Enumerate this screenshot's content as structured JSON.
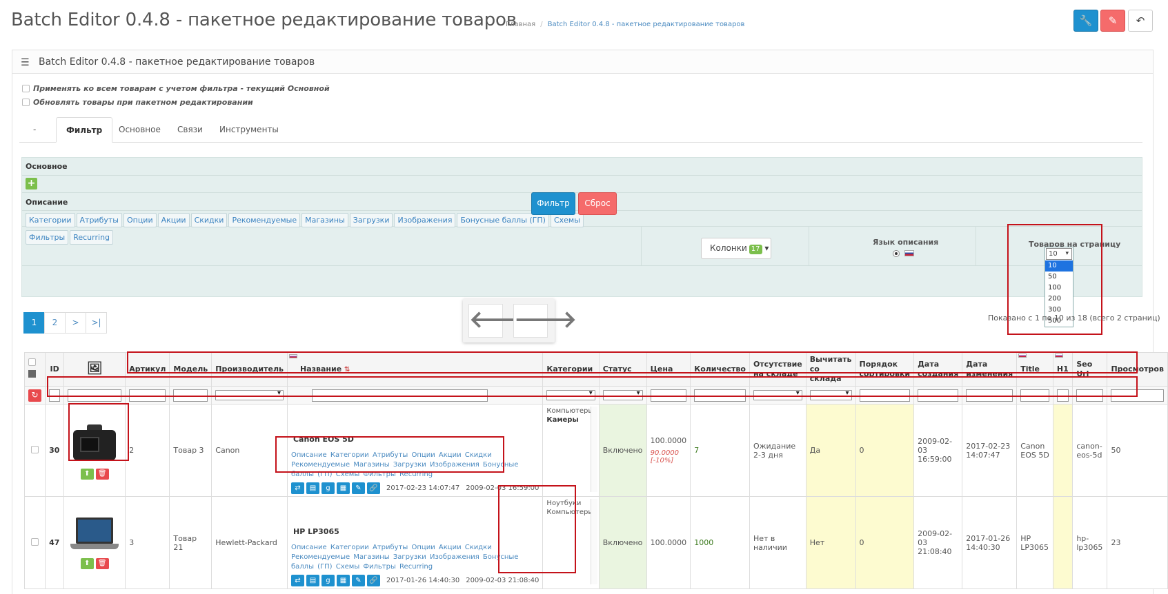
{
  "header": {
    "title": "Batch Editor 0.4.8 - пакетное редактирование товаров",
    "breadcrumb_home": "Главная",
    "breadcrumb_sep": "/",
    "breadcrumb_current": "Batch Editor 0.4.8 - пакетное редактирование товаров",
    "btn_settings_icon": "wrench-icon",
    "btn_clear_icon": "eraser-icon",
    "btn_back_icon": "back-icon"
  },
  "panel": {
    "title": "Batch Editor 0.4.8 - пакетное редактирование товаров",
    "opt_apply_all": "Применять ко всем товарам с учетом фильтра - текущий Основной",
    "opt_update": "Обновлять товары при пакетном редактировании"
  },
  "tabs": [
    "-",
    "Фильтр",
    "Основное",
    "Связи",
    "Инструменты"
  ],
  "active_tab": "Фильтр",
  "filter": {
    "section_main": "Основное",
    "section_desc": "Описание",
    "tags": [
      "Категории",
      "Атрибуты",
      "Опции",
      "Акции",
      "Скидки",
      "Рекомендуемые",
      "Магазины",
      "Загрузки",
      "Изображения",
      "Бонусные баллы (ГП)",
      "Схемы",
      "Фильтры",
      "Recurring"
    ],
    "columns_label": "Колонки",
    "columns_count": "17",
    "lang_label": "Язык описания",
    "per_page_label": "Товаров на страницу",
    "per_page_value": "10",
    "per_page_options": [
      "10",
      "50",
      "100",
      "200",
      "300",
      "500"
    ],
    "btn_filter": "Фильтр",
    "btn_reset": "Сброс"
  },
  "pagination": {
    "pages": [
      "1",
      "2",
      ">",
      ">|"
    ],
    "active": "1",
    "shown_text": "Показано с 1 по 10 из 18 (всего 2 страниц)"
  },
  "table": {
    "headers": [
      "ID",
      "",
      "Артикул",
      "Модель",
      "Производитель",
      "Название",
      "Категории",
      "Статус",
      "Цена",
      "Количество",
      "Отсутствие на складе",
      "Вычитать со склада",
      "Порядок сортировки",
      "Дата создания",
      "Дата изменения",
      "Title",
      "H1",
      "Seo Url",
      "Просмотров"
    ],
    "rows": [
      {
        "id": "30",
        "sku": "2",
        "model": "Товар 3",
        "manufacturer": "Canon",
        "name": "Canon EOS 5D",
        "links": "Описание  Категории  Атрибуты  Опции  Акции  Скидки  Рекомендуемые  Магазины  Загрузки  Изображения  Бонусные баллы (ГП)  Схемы  Фильтры  Recurring",
        "date_mod_inline": "2017-02-23 14:07:47",
        "date_add_inline": "2009-02-03 16:59:00",
        "cat1": "Компьютеры",
        "cat2": "Камеры",
        "status": "Включено",
        "price": "100.0000",
        "special": "90.0000",
        "special_pct": "[-10%]",
        "qty": "7",
        "stock_status": "Ожидание 2-3 дня",
        "subtract": "Да",
        "sort": "0",
        "date_add": "2009-02-03 16:59:00",
        "date_mod": "2017-02-23 14:07:47",
        "title": "Canon EOS 5D",
        "h1": "",
        "seo": "canon-eos-5d",
        "viewed": "50"
      },
      {
        "id": "47",
        "sku": "3",
        "model": "Товар 21",
        "manufacturer": "Hewlett-Packard",
        "name": "HP LP3065",
        "links": "Описание  Категории  Атрибуты  Опции  Акции  Скидки  Рекомендуемые  Магазины  Загрузки  Изображения  Бонусные баллы (ГП)  Схемы  Фильтры  Recurring",
        "date_mod_inline": "2017-01-26 14:40:30",
        "date_add_inline": "2009-02-03 21:08:40",
        "cat1": "Ноутбуки",
        "cat2": "Компьютеры",
        "status": "Включено",
        "price": "100.0000",
        "special": "",
        "special_pct": "",
        "qty": "1000",
        "stock_status": "Нет в наличии",
        "subtract": "Нет",
        "sort": "0",
        "date_add": "2009-02-03 21:08:40",
        "date_mod": "2017-01-26 14:40:30",
        "title": "HP LP3065",
        "h1": "",
        "seo": "hp-lp3065",
        "viewed": "23"
      }
    ]
  }
}
